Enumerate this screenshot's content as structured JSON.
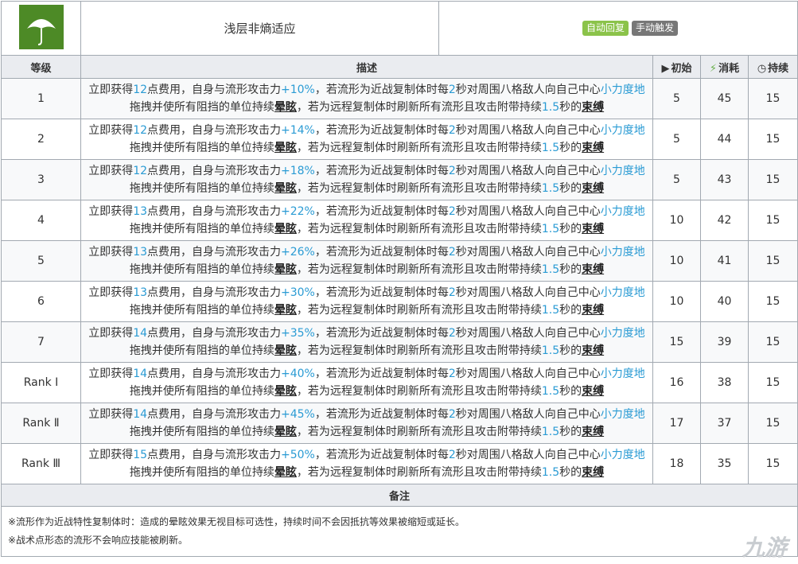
{
  "skill": {
    "name": "浅层非熵适应",
    "tags": [
      "自动回复",
      "手动触发"
    ]
  },
  "headers": {
    "level": "等级",
    "description": "描述",
    "initial": "初始",
    "cost": "消耗",
    "duration": "持续"
  },
  "rows": [
    {
      "level": "1",
      "sp": "12",
      "atk": "+10%",
      "initial": "5",
      "cost": "45",
      "duration": "15"
    },
    {
      "level": "2",
      "sp": "12",
      "atk": "+14%",
      "initial": "5",
      "cost": "44",
      "duration": "15"
    },
    {
      "level": "3",
      "sp": "12",
      "atk": "+18%",
      "initial": "5",
      "cost": "43",
      "duration": "15"
    },
    {
      "level": "4",
      "sp": "13",
      "atk": "+22%",
      "initial": "10",
      "cost": "42",
      "duration": "15"
    },
    {
      "level": "5",
      "sp": "13",
      "atk": "+26%",
      "initial": "10",
      "cost": "41",
      "duration": "15"
    },
    {
      "level": "6",
      "sp": "13",
      "atk": "+30%",
      "initial": "10",
      "cost": "40",
      "duration": "15"
    },
    {
      "level": "7",
      "sp": "14",
      "atk": "+35%",
      "initial": "15",
      "cost": "39",
      "duration": "15"
    },
    {
      "level": "Rank Ⅰ",
      "sp": "14",
      "atk": "+40%",
      "initial": "16",
      "cost": "38",
      "duration": "15"
    },
    {
      "level": "Rank Ⅱ",
      "sp": "14",
      "atk": "+45%",
      "initial": "17",
      "cost": "37",
      "duration": "15"
    },
    {
      "level": "Rank Ⅲ",
      "sp": "15",
      "atk": "+50%",
      "initial": "18",
      "cost": "35",
      "duration": "15"
    }
  ],
  "desc_parts": {
    "p1": "立即获得",
    "p2": "点费用，自身与流形攻击力",
    "p3": "，若流形为近战复制体时每",
    "interval": "2",
    "p4": "秒对周围八格敌人向自己中心",
    "pull": "小力度地",
    "p5": "拖拽并使所有阻挡的单位持续",
    "stun": "晕眩",
    "p6": "，若为远程复制体时刷新所有流形且攻击附带持续",
    "bind_dur": "1.5",
    "p7": "秒的",
    "bind": "束缚"
  },
  "notes": {
    "title": "备注",
    "lines": [
      "※流形作为近战特性复制体时：造成的晕眩效果无视目标可选性，持续时间不会因抵抗等效果被缩短或延长。",
      "※战术点形态的流形不会响应技能被刷新。"
    ]
  },
  "watermark": "九游",
  "colors": {
    "highlight": "#2a9bd4",
    "auto_tag": "#8bc34a",
    "manual_tag": "#777777",
    "icon_bg": "#5a9a2d"
  }
}
